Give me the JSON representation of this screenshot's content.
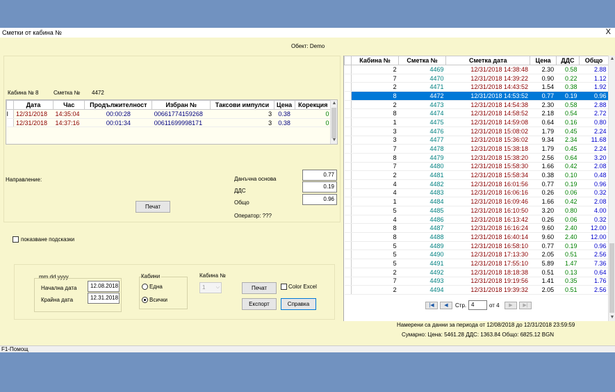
{
  "window": {
    "title": "Сметки от кабина №",
    "close": "X",
    "object_label": "Обект: Demo",
    "status": "F1-Помощ"
  },
  "detail": {
    "cabin_label": "Кабина № 8",
    "bill_label": "Сметка №",
    "bill_value": "4472",
    "columns": [
      "Дата",
      "Час",
      "Продължителност",
      "Избран №",
      "Таксови импулси",
      "Цена",
      "Корекция"
    ],
    "rows": [
      [
        "12/31/2018",
        "14:35:04",
        "00:00:28",
        "00661774159268",
        "3",
        "0.38",
        "0"
      ],
      [
        "12/31/2018",
        "14:37:16",
        "00:01:34",
        "00611699998171",
        "3",
        "0.38",
        "0"
      ]
    ],
    "direction_label": "Направление:",
    "tax_base_label": "Данъчна основа",
    "tax_base_value": "0.77",
    "vat_label": "ДДС",
    "vat_value": "0.19",
    "total_label": "Общо",
    "total_value": "0.96",
    "operator_label": "Оператор: ???",
    "print_button": "Печат"
  },
  "hints_label": "показване подсказки",
  "filter": {
    "date_format": "mm.dd.yyyy",
    "start_label": "Начална дата",
    "start_value": "12.08.2018",
    "end_label": "Крайна дата",
    "end_value": "12.31.2018",
    "cabins_label": "Кабини",
    "one_label": "Една",
    "all_label": "Всички",
    "cabin_no_label": "Кабина №",
    "cabin_no_value": "1",
    "print_button": "Печат",
    "color_excel_label": "Color Excel",
    "export_button": "Експорт",
    "report_button": "Справка"
  },
  "list": {
    "columns": [
      "Кабина №",
      "Сметка №",
      "Сметка дата",
      "Цена",
      "ДДС",
      "Общо"
    ],
    "selected_index": 3,
    "rows": [
      [
        "2",
        "4469",
        "12/31/2018 14:38:48",
        "2.30",
        "0.58",
        "2.88"
      ],
      [
        "7",
        "4470",
        "12/31/2018 14:39:22",
        "0.90",
        "0.22",
        "1.12"
      ],
      [
        "2",
        "4471",
        "12/31/2018 14:43:52",
        "1.54",
        "0.38",
        "1.92"
      ],
      [
        "8",
        "4472",
        "12/31/2018 14:53:52",
        "0.77",
        "0.19",
        "0.96"
      ],
      [
        "2",
        "4473",
        "12/31/2018 14:54:38",
        "2.30",
        "0.58",
        "2.88"
      ],
      [
        "8",
        "4474",
        "12/31/2018 14:58:52",
        "2.18",
        "0.54",
        "2.72"
      ],
      [
        "1",
        "4475",
        "12/31/2018 14:59:08",
        "0.64",
        "0.16",
        "0.80"
      ],
      [
        "3",
        "4476",
        "12/31/2018 15:08:02",
        "1.79",
        "0.45",
        "2.24"
      ],
      [
        "3",
        "4477",
        "12/31/2018 15:36:02",
        "9.34",
        "2.34",
        "11.68"
      ],
      [
        "7",
        "4478",
        "12/31/2018 15:38:18",
        "1.79",
        "0.45",
        "2.24"
      ],
      [
        "8",
        "4479",
        "12/31/2018 15:38:20",
        "2.56",
        "0.64",
        "3.20"
      ],
      [
        "7",
        "4480",
        "12/31/2018 15:58:30",
        "1.66",
        "0.42",
        "2.08"
      ],
      [
        "2",
        "4481",
        "12/31/2018 15:58:34",
        "0.38",
        "0.10",
        "0.48"
      ],
      [
        "4",
        "4482",
        "12/31/2018 16:01:56",
        "0.77",
        "0.19",
        "0.96"
      ],
      [
        "4",
        "4483",
        "12/31/2018 16:06:16",
        "0.26",
        "0.06",
        "0.32"
      ],
      [
        "1",
        "4484",
        "12/31/2018 16:09:46",
        "1.66",
        "0.42",
        "2.08"
      ],
      [
        "5",
        "4485",
        "12/31/2018 16:10:50",
        "3.20",
        "0.80",
        "4.00"
      ],
      [
        "4",
        "4486",
        "12/31/2018 16:13:42",
        "0.26",
        "0.06",
        "0.32"
      ],
      [
        "8",
        "4487",
        "12/31/2018 16:16:24",
        "9.60",
        "2.40",
        "12.00"
      ],
      [
        "8",
        "4488",
        "12/31/2018 16:40:14",
        "9.60",
        "2.40",
        "12.00"
      ],
      [
        "5",
        "4489",
        "12/31/2018 16:58:10",
        "0.77",
        "0.19",
        "0.96"
      ],
      [
        "5",
        "4490",
        "12/31/2018 17:13:30",
        "2.05",
        "0.51",
        "2.56"
      ],
      [
        "5",
        "4491",
        "12/31/2018 17:55:10",
        "5.89",
        "1.47",
        "7.36"
      ],
      [
        "2",
        "4492",
        "12/31/2018 18:18:38",
        "0.51",
        "0.13",
        "0.64"
      ],
      [
        "7",
        "4493",
        "12/31/2018 19:19:56",
        "1.41",
        "0.35",
        "1.76"
      ],
      [
        "2",
        "4494",
        "12/31/2018 19:39:32",
        "2.05",
        "0.51",
        "2.56"
      ]
    ]
  },
  "pager": {
    "page_label": "Стр.",
    "page_value": "4",
    "of_label": "от 4"
  },
  "summary": {
    "found": "Намерени са данни за периода от 12/08/2018 до 12/31/2018 23:59:59",
    "totals": "Сумарно:  Цена: 5461.28   ДДС: 1363.84   Общо: 6825.12 BGN"
  },
  "colors": {
    "date": "#8b0000",
    "number": "#000080",
    "bill": "#008080",
    "vat": "#008000",
    "total": "#0000cd",
    "selected": "#0078d7"
  }
}
